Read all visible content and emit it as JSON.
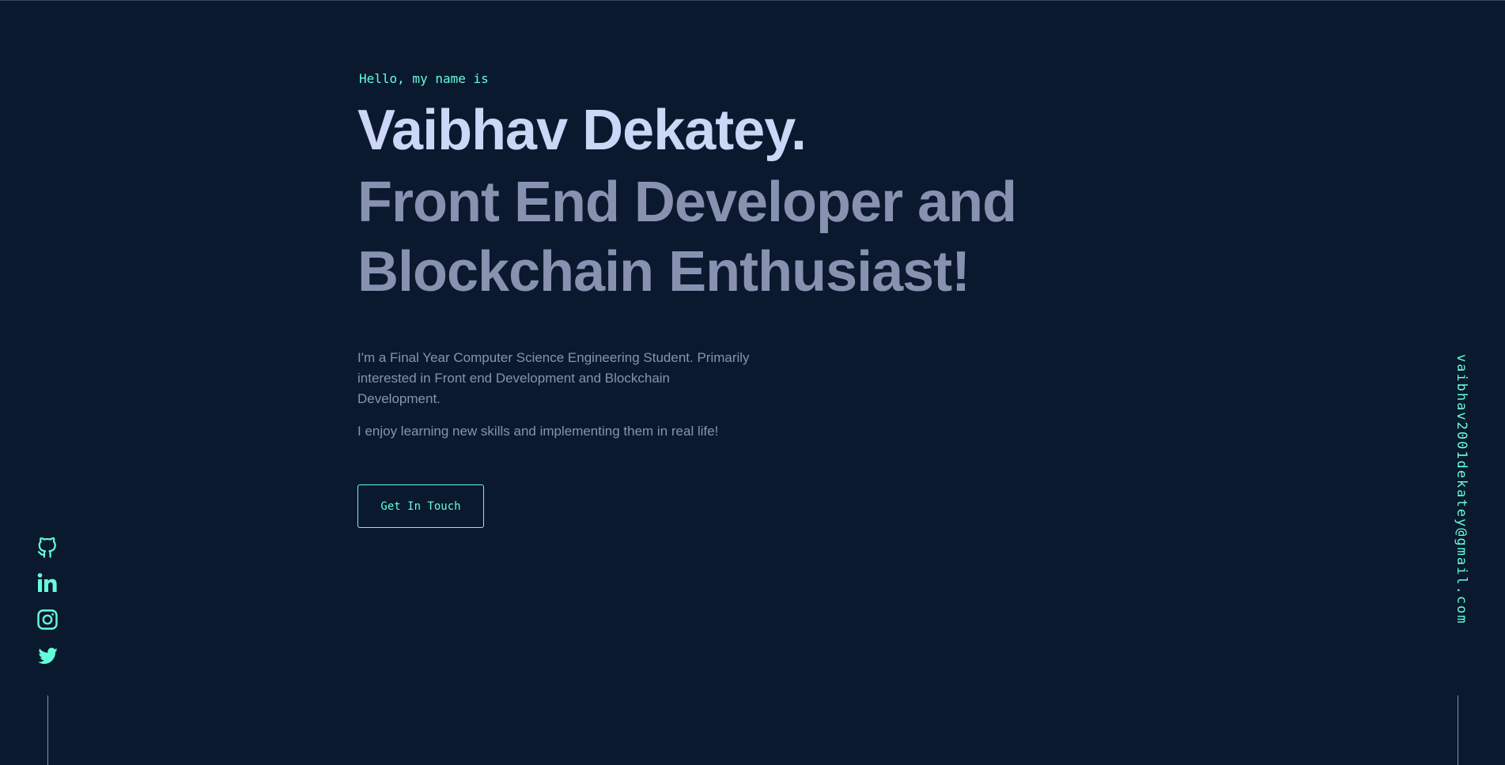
{
  "hero": {
    "greeting": "Hello, my name is",
    "name": "Vaibhav Dekatey.",
    "tagline": "Front End Developer and Blockchain Enthusiast!",
    "about": [
      "I'm a Final Year Computer Science Engineering Student. Primarily interested in Front end Development and Blockchain Development.",
      "I enjoy learning new skills and implementing them in real life!"
    ],
    "cta_label": "Get In Touch"
  },
  "social": {
    "icons": [
      "github-icon",
      "linkedin-icon",
      "instagram-icon",
      "twitter-icon"
    ]
  },
  "contact": {
    "email": "vaibhav2001dekatey@gmail.com"
  },
  "colors": {
    "background": "#0b192f",
    "accent": "#64ffda",
    "heading": "#ccd6f6",
    "text": "#8892b0"
  }
}
